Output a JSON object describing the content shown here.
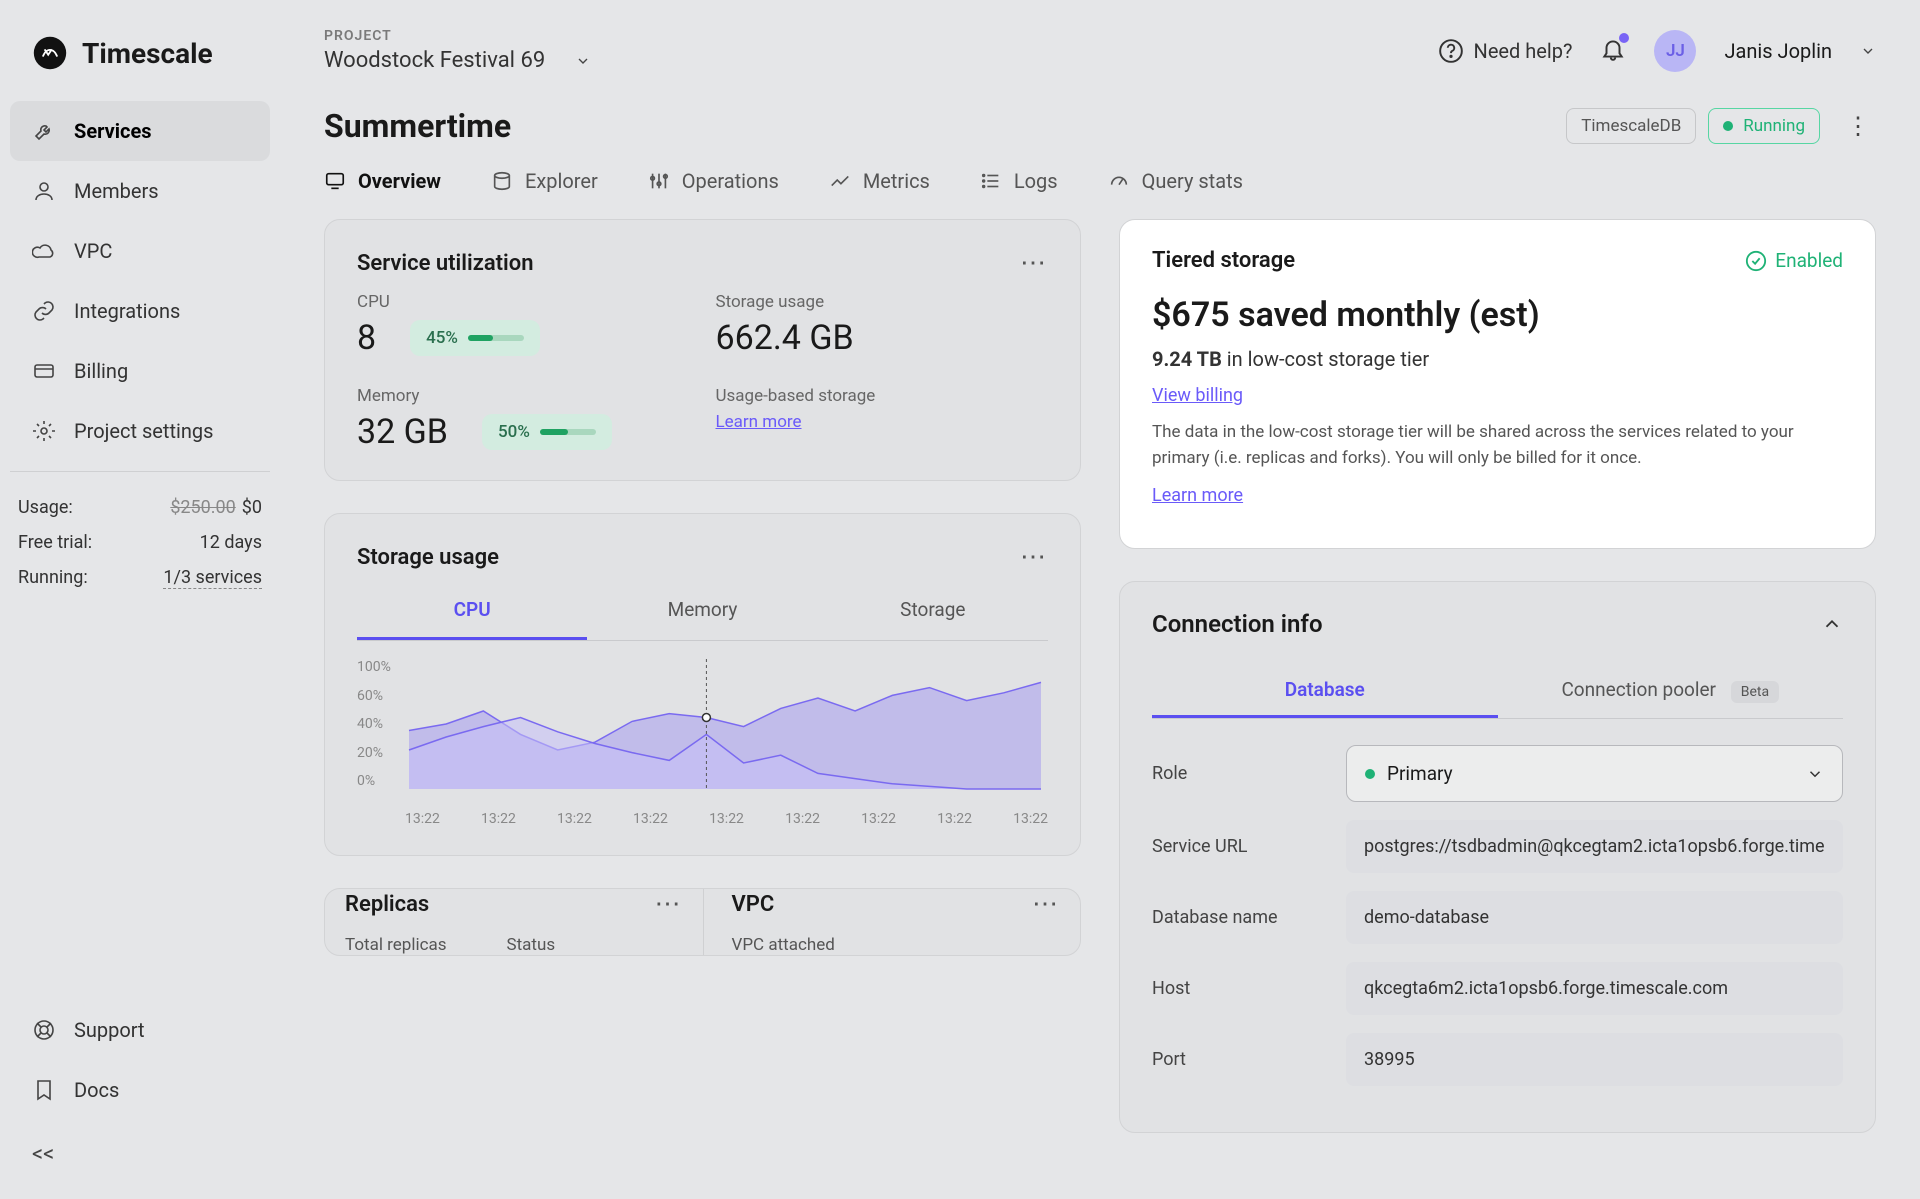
{
  "brand": "Timescale",
  "sidebar": {
    "items": [
      {
        "label": "Services"
      },
      {
        "label": "Members"
      },
      {
        "label": "VPC"
      },
      {
        "label": "Integrations"
      },
      {
        "label": "Billing"
      },
      {
        "label": "Project settings"
      }
    ],
    "usage": {
      "usage_label": "Usage:",
      "usage_old": "$250.00",
      "usage_new": "$0",
      "trial_label": "Free trial:",
      "trial_val": "12 days",
      "running_label": "Running:",
      "running_val": "1/3 services"
    },
    "support": "Support",
    "docs": "Docs"
  },
  "topbar": {
    "project_label": "PROJECT",
    "project_name": "Woodstock Festival 69",
    "help": "Need help?",
    "avatar_initials": "JJ",
    "user_name": "Janis Joplin"
  },
  "page": {
    "title": "Summertime",
    "chip_db": "TimescaleDB",
    "chip_status": "Running",
    "tabs": [
      "Overview",
      "Explorer",
      "Operations",
      "Metrics",
      "Logs",
      "Query stats"
    ]
  },
  "util": {
    "title": "Service utilization",
    "cpu_label": "CPU",
    "cpu_val": "8",
    "cpu_pct": "45%",
    "mem_label": "Memory",
    "mem_val": "32 GB",
    "mem_pct": "50%",
    "storage_label": "Storage usage",
    "storage_val": "662.4 GB",
    "ubs_label": "Usage-based storage",
    "learn": "Learn more"
  },
  "tiered": {
    "title": "Tiered storage",
    "enabled": "Enabled",
    "headline": "$675 saved monthly (est)",
    "amount": "9.24 TB",
    "amount_suffix": " in low-cost storage tier",
    "view_billing": "View billing",
    "desc": "The data in the low-cost storage tier will be shared across the services related to your primary (i.e. replicas and forks). You will only be billed for it once.",
    "learn": "Learn more"
  },
  "chart_card": {
    "title": "Storage usage",
    "tabs": [
      "CPU",
      "Memory",
      "Storage"
    ]
  },
  "chart_data": {
    "type": "area",
    "x_ticks": [
      "13:22",
      "13:22",
      "13:22",
      "13:22",
      "13:22",
      "13:22",
      "13:22",
      "13:22",
      "13:22"
    ],
    "y_ticks": [
      "100%",
      "60%",
      "40%",
      "20%",
      "0%"
    ],
    "ylim": [
      0,
      100
    ],
    "series": [
      {
        "name": "series-a",
        "values": [
          45,
          50,
          60,
          42,
          30,
          36,
          52,
          58,
          55,
          48,
          62,
          70,
          60,
          72,
          78,
          68,
          74,
          82
        ]
      },
      {
        "name": "series-b",
        "values": [
          30,
          40,
          48,
          55,
          44,
          35,
          28,
          22,
          42,
          20,
          26,
          12,
          8,
          4,
          2,
          0,
          0,
          0
        ]
      }
    ],
    "marker_index": 8
  },
  "conn": {
    "title": "Connection info",
    "tabs": {
      "db": "Database",
      "pooler": "Connection pooler",
      "beta": "Beta"
    },
    "role_label": "Role",
    "role_value": "Primary",
    "url_label": "Service URL",
    "url_value": "postgres://tsdbadmin@qkcegtam2.icta1opsb6.forge.time",
    "dbname_label": "Database name",
    "dbname_value": "demo-database",
    "host_label": "Host",
    "host_value": "qkcegta6m2.icta1opsb6.forge.timescale.com",
    "port_label": "Port",
    "port_value": "38995"
  },
  "replicas": {
    "title": "Replicas",
    "total_label": "Total replicas",
    "status_label": "Status"
  },
  "vpc": {
    "title": "VPC",
    "attached_label": "VPC attached"
  }
}
